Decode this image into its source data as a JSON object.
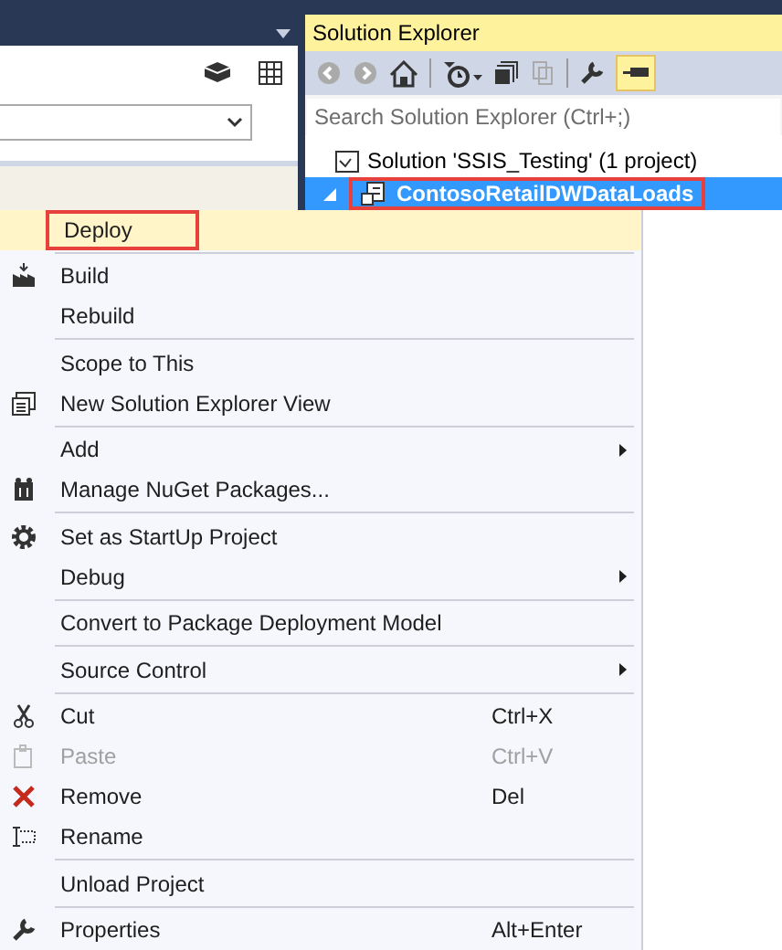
{
  "solution_explorer": {
    "title": "Solution Explorer",
    "toolbar": {
      "pin_active": true
    },
    "search": {
      "placeholder": "Search Solution Explorer (Ctrl+;)"
    },
    "tree": [
      {
        "label": "Solution 'SSIS_Testing' (1 project)",
        "selected": false,
        "outlined": false,
        "children": [
          {
            "label": "ContosoRetailDWDataLoads",
            "selected": true,
            "outlined": true,
            "expanded": true
          }
        ]
      }
    ]
  },
  "context_menu": [
    {
      "kind": "item",
      "label": "Deploy",
      "selected": true,
      "outlined": true,
      "disabled": false,
      "submenu": false
    },
    {
      "kind": "separator"
    },
    {
      "kind": "item",
      "label": "Build",
      "selected": false,
      "outlined": false,
      "disabled": false,
      "submenu": false
    },
    {
      "kind": "item",
      "label": "Rebuild",
      "selected": false,
      "outlined": false,
      "disabled": false,
      "submenu": false
    },
    {
      "kind": "separator"
    },
    {
      "kind": "item",
      "label": "Scope to This",
      "selected": false,
      "outlined": false,
      "disabled": false,
      "submenu": false
    },
    {
      "kind": "item",
      "label": "New Solution Explorer View",
      "selected": false,
      "outlined": false,
      "disabled": false,
      "submenu": false
    },
    {
      "kind": "separator"
    },
    {
      "kind": "item",
      "label": "Add",
      "selected": false,
      "outlined": false,
      "disabled": false,
      "submenu": true
    },
    {
      "kind": "item",
      "label": "Manage NuGet Packages...",
      "selected": false,
      "outlined": false,
      "disabled": false,
      "submenu": false
    },
    {
      "kind": "separator"
    },
    {
      "kind": "item",
      "label": "Set as StartUp Project",
      "selected": false,
      "outlined": false,
      "disabled": false,
      "submenu": false
    },
    {
      "kind": "item",
      "label": "Debug",
      "selected": false,
      "outlined": false,
      "disabled": false,
      "submenu": true
    },
    {
      "kind": "separator"
    },
    {
      "kind": "item",
      "label": "Convert to Package Deployment Model",
      "selected": false,
      "outlined": false,
      "disabled": false,
      "submenu": false
    },
    {
      "kind": "separator"
    },
    {
      "kind": "item",
      "label": "Source Control",
      "selected": false,
      "outlined": false,
      "disabled": false,
      "submenu": true
    },
    {
      "kind": "separator"
    },
    {
      "kind": "item",
      "label": "Cut",
      "shortcut": "Ctrl+X",
      "selected": false,
      "outlined": false,
      "disabled": false,
      "submenu": false
    },
    {
      "kind": "item",
      "label": "Paste",
      "shortcut": "Ctrl+V",
      "selected": false,
      "outlined": false,
      "disabled": true,
      "submenu": false
    },
    {
      "kind": "item",
      "label": "Remove",
      "shortcut": "Del",
      "selected": false,
      "outlined": false,
      "disabled": false,
      "submenu": false
    },
    {
      "kind": "item",
      "label": "Rename",
      "selected": false,
      "outlined": false,
      "disabled": false,
      "submenu": false
    },
    {
      "kind": "separator"
    },
    {
      "kind": "item",
      "label": "Unload Project",
      "selected": false,
      "outlined": false,
      "disabled": false,
      "submenu": false
    },
    {
      "kind": "separator"
    },
    {
      "kind": "item",
      "label": "Properties",
      "shortcut": "Alt+Enter",
      "selected": false,
      "outlined": false,
      "disabled": false,
      "submenu": false
    }
  ]
}
